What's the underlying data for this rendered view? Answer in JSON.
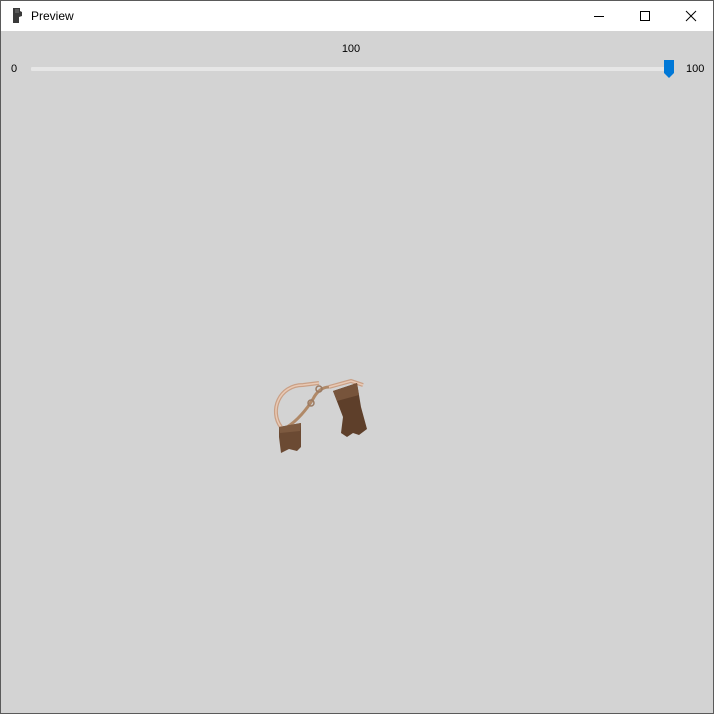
{
  "window": {
    "title": "Preview",
    "app_icon": "boot-icon",
    "controls": {
      "minimize_icon": "minimize-icon",
      "maximize_icon": "maximize-icon",
      "close_icon": "close-icon"
    }
  },
  "slider": {
    "current_value": "100",
    "min_label": "0",
    "max_label": "100",
    "value_fraction": 1.0,
    "accent_color": "#0078d7"
  },
  "preview": {
    "background_color": "#d3d3d3",
    "model": "brown-leather-armor-piece"
  }
}
